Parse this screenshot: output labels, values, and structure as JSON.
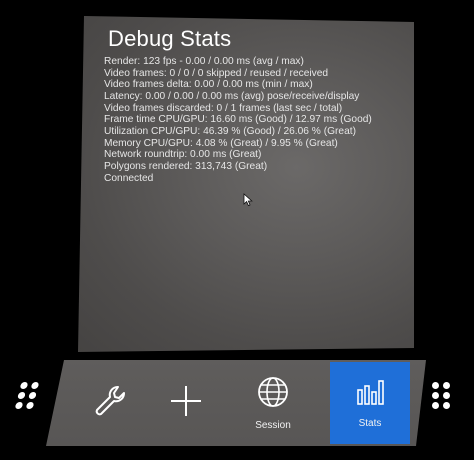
{
  "panel": {
    "title": "Debug Stats",
    "lines": [
      "Render: 123 fps - 0.00 / 0.00 ms (avg / max)",
      "Video frames: 0 / 0 / 0 skipped / reused / received",
      "Video frames delta: 0.00 / 0.00 ms (min / max)",
      "Latency: 0.00 / 0.00 / 0.00 ms (avg) pose/receive/display",
      "Video frames discarded: 0 / 1 frames (last sec / total)",
      "Frame time CPU/GPU: 16.60 ms (Good) / 12.97 ms (Good)",
      "Utilization CPU/GPU: 46.39 % (Good) / 26.06 % (Great)",
      "Memory CPU/GPU: 4.08 % (Great) / 9.95 % (Great)",
      "Network roundtrip: 0.00 ms (Great)",
      "Polygons rendered: 313,743 (Great)",
      "Connected"
    ]
  },
  "toolbar": {
    "tools_icon": "wrench-icon",
    "add_icon": "plus-icon",
    "session_icon": "globe-icon",
    "session_label": "Session",
    "stats_icon": "bar-chart-icon",
    "stats_label": "Stats",
    "active_tab": "Stats",
    "active_color": "#1f6fd8"
  },
  "grips": {
    "left_icon": "drag-handle-icon",
    "right_icon": "drag-handle-icon"
  }
}
